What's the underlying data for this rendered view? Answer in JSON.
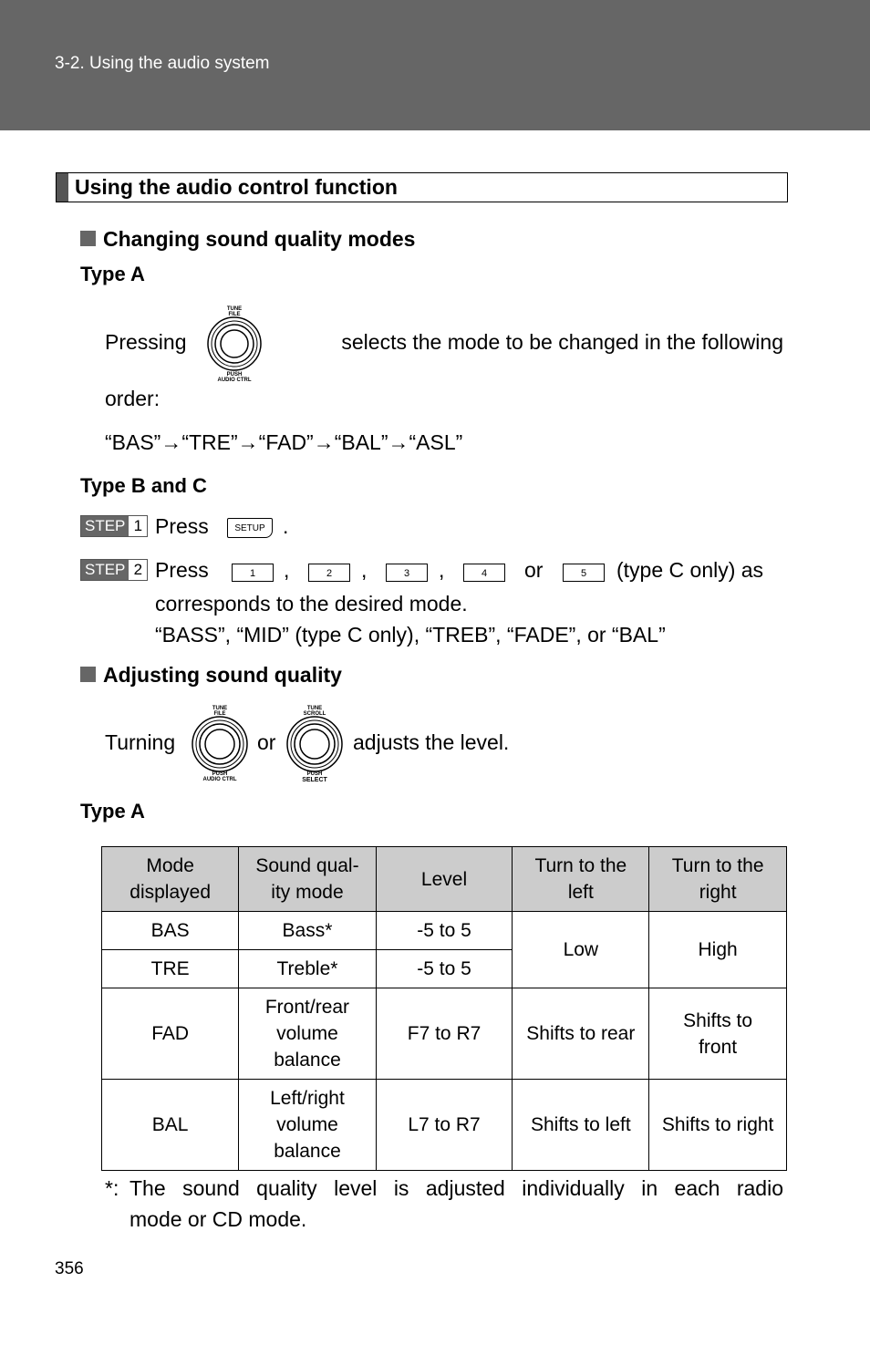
{
  "header": {
    "breadcrumb": "3-2. Using the audio system",
    "background": "#666666"
  },
  "section": {
    "title": "Using the audio control function"
  },
  "changing": {
    "heading": "Changing sound quality modes",
    "type_a": {
      "label": "Type A",
      "pressing": "Pressing",
      "after_knob": "selects the mode to be changed in the following",
      "order_label": "order:",
      "sequence": "“BAS”→“TRE”→“FAD”→“BAL”→“ASL”",
      "knob": {
        "top": [
          "TUNE",
          "FILE"
        ],
        "bottom": [
          "PUSH",
          "AUDIO CTRL"
        ]
      }
    },
    "type_bc": {
      "label": "Type B and C",
      "step1": {
        "step": "STEP",
        "num": "1",
        "text": "Press",
        "button": "SETUP",
        "end": "."
      },
      "step2": {
        "step": "STEP",
        "num": "2",
        "text": "Press",
        "buttons": [
          "1",
          "2",
          "3",
          "4",
          "5"
        ],
        "comma": ",",
        "or": "or",
        "suffix": "(type C only) as",
        "line2": "corresponds to the desired mode.",
        "line3": "“BASS”, “MID” (type C only), “TREB”, “FADE”, or “BAL”"
      }
    }
  },
  "adjusting": {
    "heading": "Adjusting sound quality",
    "turning": "Turning",
    "or": "or",
    "suffix": "adjusts the level.",
    "knob1": {
      "top": [
        "TUNE",
        "FILE"
      ],
      "bottom": [
        "PUSH",
        "AUDIO CTRL"
      ]
    },
    "knob2": {
      "top": [
        "TUNE",
        "SCROLL"
      ],
      "bottom": [
        "PUSH",
        "SELECT"
      ]
    },
    "type_a_label": "Type A"
  },
  "table": {
    "headers": [
      "Mode displayed",
      "Sound qual-ity mode",
      "Level",
      "Turn to the left",
      "Turn to the right"
    ],
    "header_lines": [
      [
        "Mode",
        "displayed"
      ],
      [
        "Sound qual-",
        "ity mode"
      ],
      [
        "Level"
      ],
      [
        "Turn to the",
        "left"
      ],
      [
        "Turn to the",
        "right"
      ]
    ],
    "rows": [
      {
        "mode": "BAS",
        "quality": "Bass*",
        "level": "-5 to 5",
        "left": "Low",
        "right": "High"
      },
      {
        "mode": "TRE",
        "quality": "Treble*",
        "level": "-5 to 5",
        "left": "Low",
        "right": "High"
      },
      {
        "mode": "FAD",
        "quality_lines": [
          "Front/rear",
          "volume",
          "balance"
        ],
        "level": "F7 to R7",
        "left": "Shifts to rear",
        "right_lines": [
          "Shifts to",
          "front"
        ]
      },
      {
        "mode": "BAL",
        "quality_lines": [
          "Left/right",
          "volume",
          "balance"
        ],
        "level": "L7 to R7",
        "left": "Shifts to left",
        "right": "Shifts to right"
      }
    ],
    "header_bg": "#cccccc"
  },
  "footnote": {
    "marker": "*:",
    "line1": "The sound quality level is adjusted individually in each radio",
    "line2": "mode or CD mode."
  },
  "page_number": "356"
}
